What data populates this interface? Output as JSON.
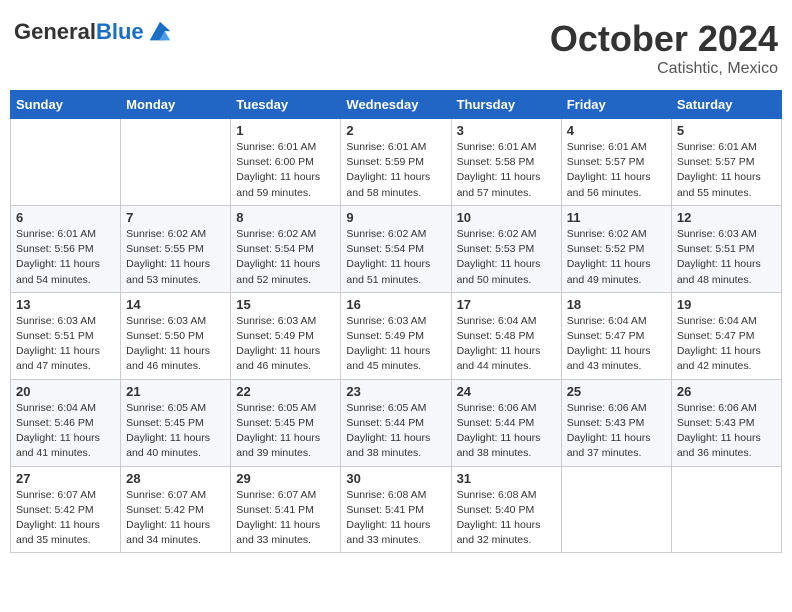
{
  "header": {
    "logo_general": "General",
    "logo_blue": "Blue",
    "month_title": "October 2024",
    "location": "Catishtic, Mexico"
  },
  "weekdays": [
    "Sunday",
    "Monday",
    "Tuesday",
    "Wednesday",
    "Thursday",
    "Friday",
    "Saturday"
  ],
  "weeks": [
    [
      {
        "day": "",
        "info": ""
      },
      {
        "day": "",
        "info": ""
      },
      {
        "day": "1",
        "info": "Sunrise: 6:01 AM\nSunset: 6:00 PM\nDaylight: 11 hours and 59 minutes."
      },
      {
        "day": "2",
        "info": "Sunrise: 6:01 AM\nSunset: 5:59 PM\nDaylight: 11 hours and 58 minutes."
      },
      {
        "day": "3",
        "info": "Sunrise: 6:01 AM\nSunset: 5:58 PM\nDaylight: 11 hours and 57 minutes."
      },
      {
        "day": "4",
        "info": "Sunrise: 6:01 AM\nSunset: 5:57 PM\nDaylight: 11 hours and 56 minutes."
      },
      {
        "day": "5",
        "info": "Sunrise: 6:01 AM\nSunset: 5:57 PM\nDaylight: 11 hours and 55 minutes."
      }
    ],
    [
      {
        "day": "6",
        "info": "Sunrise: 6:01 AM\nSunset: 5:56 PM\nDaylight: 11 hours and 54 minutes."
      },
      {
        "day": "7",
        "info": "Sunrise: 6:02 AM\nSunset: 5:55 PM\nDaylight: 11 hours and 53 minutes."
      },
      {
        "day": "8",
        "info": "Sunrise: 6:02 AM\nSunset: 5:54 PM\nDaylight: 11 hours and 52 minutes."
      },
      {
        "day": "9",
        "info": "Sunrise: 6:02 AM\nSunset: 5:54 PM\nDaylight: 11 hours and 51 minutes."
      },
      {
        "day": "10",
        "info": "Sunrise: 6:02 AM\nSunset: 5:53 PM\nDaylight: 11 hours and 50 minutes."
      },
      {
        "day": "11",
        "info": "Sunrise: 6:02 AM\nSunset: 5:52 PM\nDaylight: 11 hours and 49 minutes."
      },
      {
        "day": "12",
        "info": "Sunrise: 6:03 AM\nSunset: 5:51 PM\nDaylight: 11 hours and 48 minutes."
      }
    ],
    [
      {
        "day": "13",
        "info": "Sunrise: 6:03 AM\nSunset: 5:51 PM\nDaylight: 11 hours and 47 minutes."
      },
      {
        "day": "14",
        "info": "Sunrise: 6:03 AM\nSunset: 5:50 PM\nDaylight: 11 hours and 46 minutes."
      },
      {
        "day": "15",
        "info": "Sunrise: 6:03 AM\nSunset: 5:49 PM\nDaylight: 11 hours and 46 minutes."
      },
      {
        "day": "16",
        "info": "Sunrise: 6:03 AM\nSunset: 5:49 PM\nDaylight: 11 hours and 45 minutes."
      },
      {
        "day": "17",
        "info": "Sunrise: 6:04 AM\nSunset: 5:48 PM\nDaylight: 11 hours and 44 minutes."
      },
      {
        "day": "18",
        "info": "Sunrise: 6:04 AM\nSunset: 5:47 PM\nDaylight: 11 hours and 43 minutes."
      },
      {
        "day": "19",
        "info": "Sunrise: 6:04 AM\nSunset: 5:47 PM\nDaylight: 11 hours and 42 minutes."
      }
    ],
    [
      {
        "day": "20",
        "info": "Sunrise: 6:04 AM\nSunset: 5:46 PM\nDaylight: 11 hours and 41 minutes."
      },
      {
        "day": "21",
        "info": "Sunrise: 6:05 AM\nSunset: 5:45 PM\nDaylight: 11 hours and 40 minutes."
      },
      {
        "day": "22",
        "info": "Sunrise: 6:05 AM\nSunset: 5:45 PM\nDaylight: 11 hours and 39 minutes."
      },
      {
        "day": "23",
        "info": "Sunrise: 6:05 AM\nSunset: 5:44 PM\nDaylight: 11 hours and 38 minutes."
      },
      {
        "day": "24",
        "info": "Sunrise: 6:06 AM\nSunset: 5:44 PM\nDaylight: 11 hours and 38 minutes."
      },
      {
        "day": "25",
        "info": "Sunrise: 6:06 AM\nSunset: 5:43 PM\nDaylight: 11 hours and 37 minutes."
      },
      {
        "day": "26",
        "info": "Sunrise: 6:06 AM\nSunset: 5:43 PM\nDaylight: 11 hours and 36 minutes."
      }
    ],
    [
      {
        "day": "27",
        "info": "Sunrise: 6:07 AM\nSunset: 5:42 PM\nDaylight: 11 hours and 35 minutes."
      },
      {
        "day": "28",
        "info": "Sunrise: 6:07 AM\nSunset: 5:42 PM\nDaylight: 11 hours and 34 minutes."
      },
      {
        "day": "29",
        "info": "Sunrise: 6:07 AM\nSunset: 5:41 PM\nDaylight: 11 hours and 33 minutes."
      },
      {
        "day": "30",
        "info": "Sunrise: 6:08 AM\nSunset: 5:41 PM\nDaylight: 11 hours and 33 minutes."
      },
      {
        "day": "31",
        "info": "Sunrise: 6:08 AM\nSunset: 5:40 PM\nDaylight: 11 hours and 32 minutes."
      },
      {
        "day": "",
        "info": ""
      },
      {
        "day": "",
        "info": ""
      }
    ]
  ]
}
